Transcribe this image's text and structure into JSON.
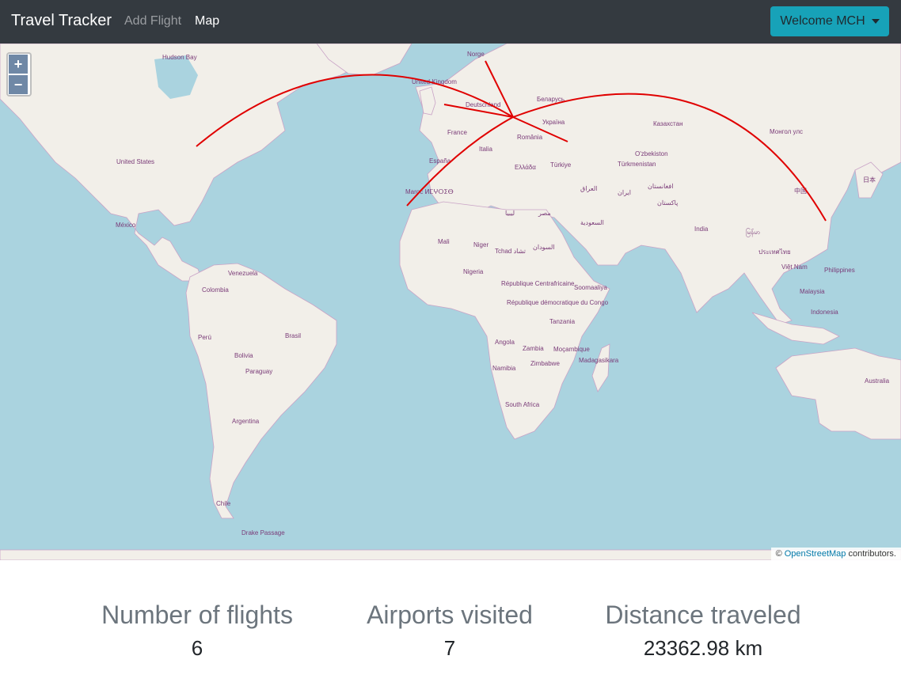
{
  "navbar": {
    "brand": "Travel Tracker",
    "add_flight": "Add Flight",
    "map": "Map",
    "welcome": "Welcome MCH"
  },
  "map": {
    "zoom_in": "+",
    "zoom_out": "−",
    "attribution_prefix": "© ",
    "attribution_link": "OpenStreetMap",
    "attribution_suffix": " contributors.",
    "route_color": "#e00000",
    "labels": {
      "hudson_bay": "Hudson Bay",
      "united_states": "United States",
      "mexico": "México",
      "venezuela": "Venezuela",
      "colombia": "Colombia",
      "peru": "Perú",
      "brasil": "Brasil",
      "bolivia": "Bolivia",
      "paraguay": "Paraguay",
      "argentina": "Argentina",
      "chile": "Chile",
      "norge": "Norge",
      "united_kingdom": "United Kingdom",
      "deutschland": "Deutschland",
      "belarus": "Беларусь",
      "ukraina": "Україна",
      "france": "France",
      "espana": "España",
      "italia": "Italia",
      "romania": "România",
      "ellada": "Ελλάδα",
      "turkiye": "Türkiye",
      "maroc": "Maroc ⵍⵎⵖⵔⵉⴱ",
      "libya": "ليبيا",
      "misr": "مصر",
      "mali": "Mali",
      "niger": "Niger",
      "tchad": "Tchad تشاد",
      "nigeria": "Nigeria",
      "sudan": "السودان",
      "rca": "République Centrafricaine",
      "rdc": "République démocratique du Congo",
      "tanzania": "Tanzania",
      "angola": "Angola",
      "zambia": "Zambia",
      "mocambique": "Moçambique",
      "namibia": "Namibia",
      "zimbabwe": "Zimbabwe",
      "madagasikara": "Madagasikara",
      "south_africa": "South Africa",
      "soomaaliya": "Soomaaliya",
      "kazakhstan": "Казахстан",
      "mongol": "Монгол улс",
      "uzbekistan": "O'zbekiston",
      "turkmenistan": "Türkmenistan",
      "iraq": "العراق",
      "iran": "ایران",
      "afghanistan": "افغانستان",
      "pakistan": "پاکستان",
      "saudi": "السعودية",
      "india": "India",
      "china": "中国",
      "myanmar": "မြန်မာ",
      "thailand": "ประเทศไทย",
      "vietnam": "Việt Nam",
      "philippines": "Philippines",
      "malaysia": "Malaysia",
      "indonesia": "Indonesia",
      "australia": "Australia",
      "nihon": "日本",
      "drake": "Drake Passage"
    }
  },
  "stats": {
    "flights_label": "Number of flights",
    "flights_value": "6",
    "airports_label": "Airports visited",
    "airports_value": "7",
    "distance_label": "Distance traveled",
    "distance_value": "23362.98 km"
  }
}
